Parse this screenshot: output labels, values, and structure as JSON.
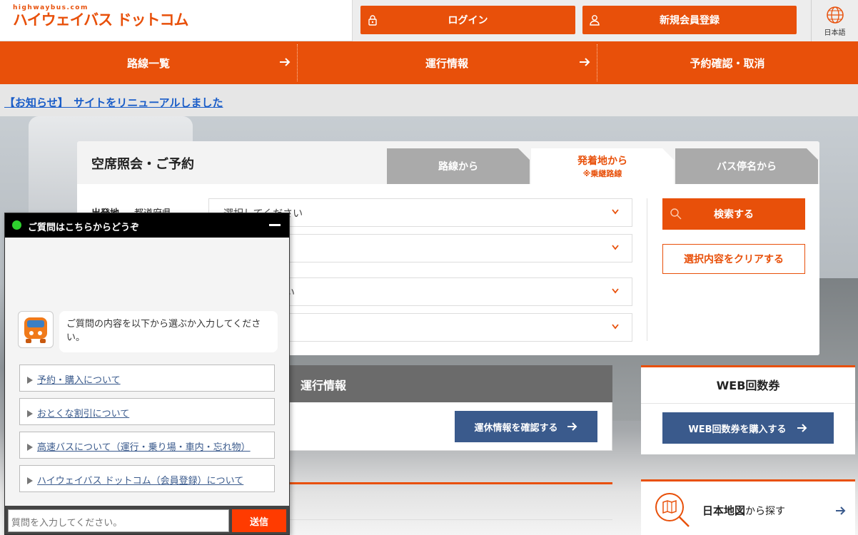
{
  "header": {
    "logo_small": "highwaybus.com",
    "logo_main": "ハイウェイバス ドットコム",
    "login_label": "ログイン",
    "register_label": "新規会員登録",
    "language_label": "日本語"
  },
  "nav": {
    "items": [
      {
        "label": "路線一覧"
      },
      {
        "label": "運行情報"
      },
      {
        "label": "予約確認・取消"
      }
    ]
  },
  "notice": {
    "text": "【お知らせ】　サイトをリニューアルしました"
  },
  "search_panel": {
    "title": "空席照会・ご予約",
    "tabs": [
      {
        "label": "路線から",
        "sub": ""
      },
      {
        "label": "発着地から",
        "sub": "※乗継路線"
      },
      {
        "label": "バス停名から",
        "sub": ""
      }
    ],
    "departure_label": "出発地",
    "prefecture_label": "都道府県",
    "selects": [
      {
        "value": "選択してください"
      },
      {
        "value": ""
      },
      {
        "value": "さい"
      },
      {
        "value": ""
      }
    ],
    "search_button": "検索する",
    "clear_button": "選択内容をクリアする"
  },
  "operation": {
    "title": "運行情報",
    "button": "運休情報を確認する"
  },
  "web_ticket": {
    "title": "WEB回数券",
    "button": "WEB回数券を購入する"
  },
  "map_search": {
    "strong": "日本地図",
    "suffix": "から探す"
  },
  "chat": {
    "title": "ご質問はこちらからどうぞ",
    "message": "ご質問の内容を以下から選ぶか入力してください。",
    "options": [
      {
        "label": "予約・購入について"
      },
      {
        "label": "おとくな割引について"
      },
      {
        "label": "高速バスについて（運行・乗り場・車内・忘れ物）"
      },
      {
        "label": "ハイウェイバス ドットコム（会員登録）について"
      }
    ],
    "input_placeholder": "質問を入力してください。",
    "send_label": "送信"
  },
  "colors": {
    "brand_orange": "#e8500a",
    "navy": "#3a5a8c",
    "chat_send": "#ff3b00"
  }
}
